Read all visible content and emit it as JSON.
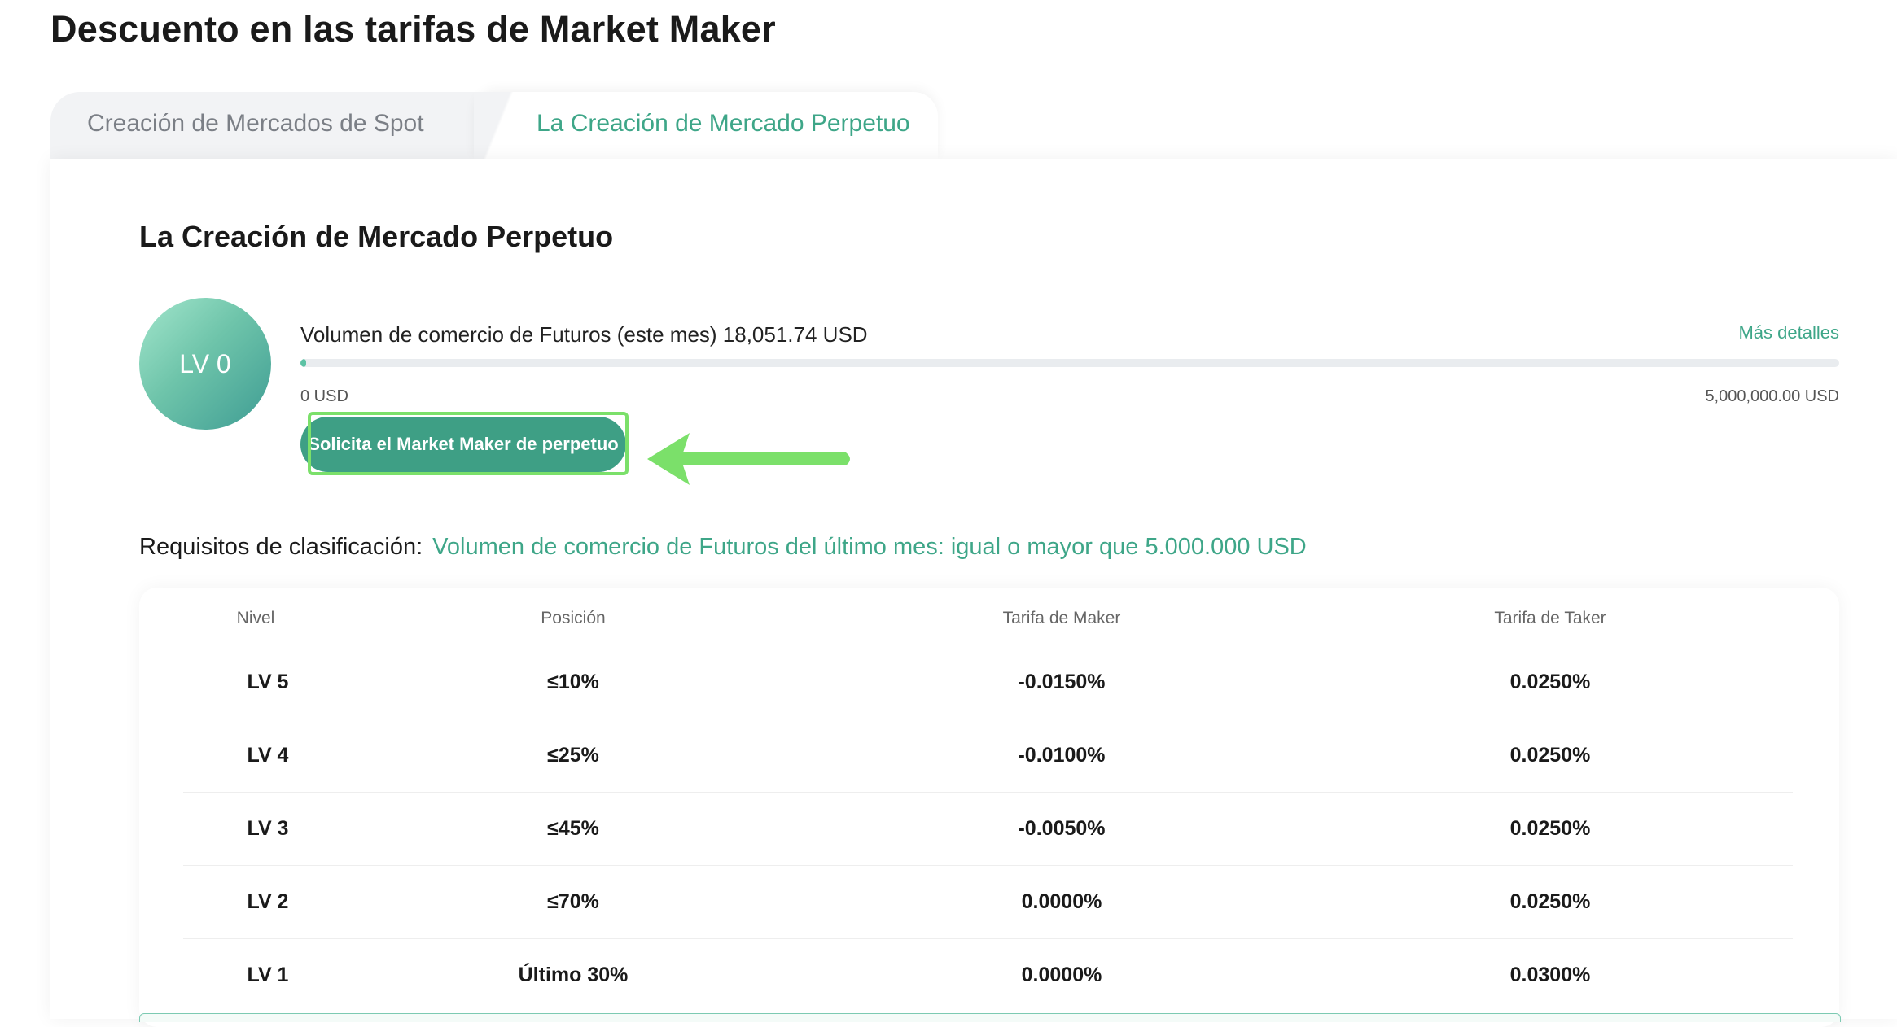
{
  "page": {
    "title": "Descuento en las tarifas de Market Maker"
  },
  "tabs": [
    {
      "label": "Creación de Mercados de Spot",
      "active": false
    },
    {
      "label": "La Creación de Mercado Perpetuo",
      "active": true
    }
  ],
  "section": {
    "title": "La Creación de Mercado Perpetuo",
    "level_badge": "LV 0",
    "volume_label": "Volumen de comercio de Futuros (este mes) 18,051.74 USD",
    "more_details": "Más detalles",
    "progress_fraction": 0.0036,
    "range_min": "0 USD",
    "range_max": "5,000,000.00 USD",
    "apply_button": "Solicita el Market Maker de perpetuo"
  },
  "requirements": {
    "label": "Requisitos de clasificación:",
    "value": "Volumen de comercio de Futuros del último mes: igual o mayor que 5.000.000 USD"
  },
  "table": {
    "headers": [
      "Nivel",
      "Posición",
      "Tarifa de Maker",
      "Tarifa de Taker"
    ],
    "rows": [
      [
        "LV 5",
        "≤10%",
        "-0.0150%",
        "0.0250%"
      ],
      [
        "LV 4",
        "≤25%",
        "-0.0100%",
        "0.0250%"
      ],
      [
        "LV 3",
        "≤45%",
        "-0.0050%",
        "0.0250%"
      ],
      [
        "LV 2",
        "≤70%",
        "0.0000%",
        "0.0250%"
      ],
      [
        "LV 1",
        "Último 30%",
        "0.0000%",
        "0.0300%"
      ]
    ]
  },
  "colors": {
    "accent": "#3ea688",
    "button": "#3e9f85",
    "highlight": "#7be06a",
    "arrow": "#7be06a"
  },
  "icons": {
    "arrow": "arrow-left-icon"
  }
}
